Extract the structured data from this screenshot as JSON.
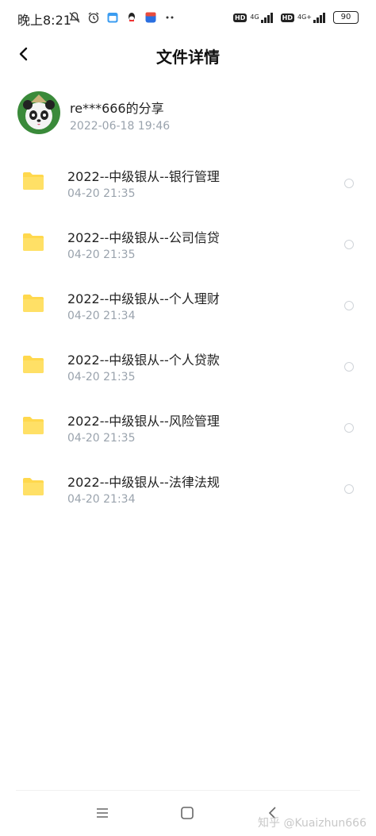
{
  "status_bar": {
    "time": "晚上8:21",
    "network_1": "4G",
    "network_2": "4G+",
    "hd_label": "HD",
    "battery": "90"
  },
  "header": {
    "title": "文件详情"
  },
  "sharer": {
    "name": "re***666的分享",
    "time": "2022-06-18  19:46"
  },
  "files": [
    {
      "name": "2022--中级银从--银行管理",
      "time": "04-20  21:35"
    },
    {
      "name": "2022--中级银从--公司信贷",
      "time": "04-20  21:35"
    },
    {
      "name": "2022--中级银从--个人理财",
      "time": "04-20  21:34"
    },
    {
      "name": "2022--中级银从--个人贷款",
      "time": "04-20  21:35"
    },
    {
      "name": "2022--中级银从--风险管理",
      "time": "04-20  21:35"
    },
    {
      "name": "2022--中级银从--法律法规",
      "time": "04-20  21:34"
    }
  ],
  "watermark": "知乎 @Kuaizhun666",
  "colors": {
    "folder": "#FFD84D",
    "secondary_text": "#9aa3ad",
    "avatar_bg": "#3a8a3a"
  }
}
